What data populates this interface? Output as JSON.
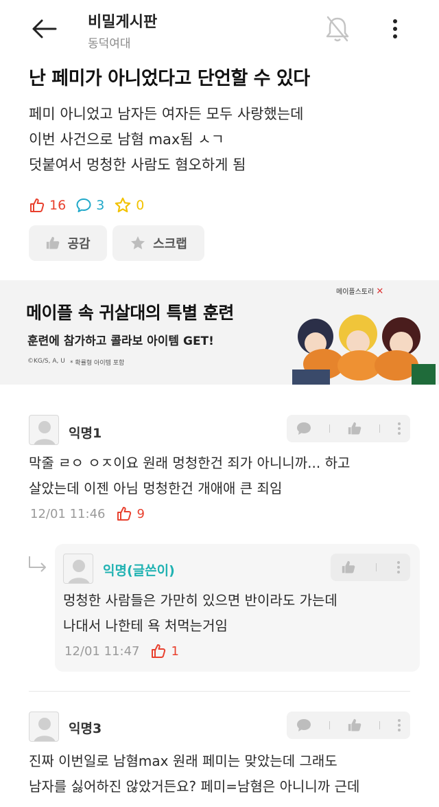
{
  "header": {
    "board_title": "비밀게시판",
    "board_subtitle": "동덕여대",
    "icons": [
      "back-arrow-icon",
      "bell-off-icon",
      "more-vertical-icon"
    ]
  },
  "post": {
    "title": "난 페미가 아니었다고 단언할 수 있다",
    "body_lines": [
      "페미 아니었고 남자든 여자든 모두 사랑했는데",
      "이번 사건으로 남혐 max됨 ㅅㄱ",
      "덧붙여서 멍청한 사람도 혐오하게 됨"
    ],
    "likes": "16",
    "comments": "3",
    "scraps": "0",
    "empathy_label": "공감",
    "scrap_label": "스크랩"
  },
  "banner": {
    "title": "메이플 속 귀살대의 특별 훈련",
    "subtitle": "훈련에 참가하고 콜라보 아이템 GET!",
    "copyright": "©KG/S, A, U",
    "note": "* 확률형 아이템 포함",
    "logo_text": "메이플스토리"
  },
  "comments": [
    {
      "author": "익명1",
      "lines": [
        "막줄 ㄹㅇ ㅇㅈ이요 원래 멍청한건 죄가 아니니까... 하고",
        "살았는데 이젠 아님 멍청한건 개애애 큰 죄임"
      ],
      "time": "12/01 11:46",
      "likes": "9"
    },
    {
      "author": "익명(글쓴이)",
      "lines": [
        "멍청한 사람들은 가만히 있으면 반이라도 가는데",
        "나대서 나한테 욕 처먹는거임"
      ],
      "time": "12/01 11:47",
      "likes": "1"
    },
    {
      "author": "익명3",
      "lines": [
        "진짜 이번일로 남혐max 원래 페미는 맞았는데 그래도",
        "남자를 싫어하진 않았거든요? 페미=남혐은 아니니까 근데"
      ]
    }
  ],
  "colors": {
    "like_red": "#e8402e",
    "comment_cyan": "#1fa8c9",
    "scrap_yellow": "#f2c200",
    "op_teal": "#20b2b2"
  }
}
